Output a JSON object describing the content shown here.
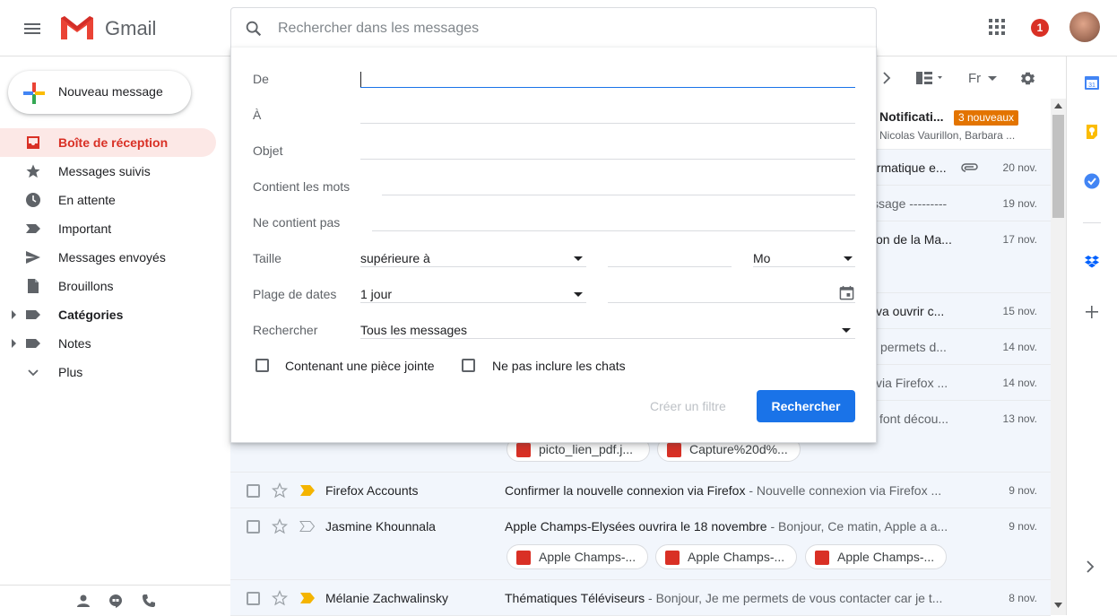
{
  "app": {
    "logo_text": "Gmail",
    "notification_count": "1"
  },
  "search": {
    "placeholder": "Rechercher dans les messages"
  },
  "compose": {
    "label": "Nouveau message"
  },
  "sidebar": {
    "items": [
      {
        "label": "Boîte de réception",
        "icon": "inbox-icon"
      },
      {
        "label": "Messages suivis",
        "icon": "star-icon"
      },
      {
        "label": "En attente",
        "icon": "clock-icon"
      },
      {
        "label": "Important",
        "icon": "important-icon"
      },
      {
        "label": "Messages envoyés",
        "icon": "send-icon"
      },
      {
        "label": "Brouillons",
        "icon": "draft-icon"
      },
      {
        "label": "Catégories",
        "icon": "label-icon"
      },
      {
        "label": "Notes",
        "icon": "label-icon"
      },
      {
        "label": "Plus",
        "icon": "chevron-down-icon"
      }
    ]
  },
  "toolbar": {
    "language": "Fr"
  },
  "promo": {
    "title": "Notificati...",
    "badge": "3 nouveaux",
    "senders": "Nicolas Vaurillon, Barbara ..."
  },
  "emails": [
    {
      "fragment": "ormatique e...",
      "date": "20 nov."
    },
    {
      "fragment": "ssage ---------",
      "date": "19 nov."
    },
    {
      "fragment": "on de la Ma...",
      "date": "17 nov."
    },
    {
      "fragment": "va ouvrir c...",
      "date": "15 nov."
    },
    {
      "fragment": "permets d...",
      "date": "14 nov."
    },
    {
      "fragment": "via Firefox ...",
      "date": "14 nov."
    },
    {
      "fragment": "font décou...",
      "date": "13 nov."
    }
  ],
  "row7_chips": [
    "picto_lien_pdf.j...",
    "Capture%20d%..."
  ],
  "full_rows": [
    {
      "sender": "Firefox Accounts",
      "subject": "Confirmer la nouvelle connexion via Firefox",
      "snippet": " - Nouvelle connexion via Firefox ...",
      "date": "9 nov."
    },
    {
      "sender": "Jasmine Khounnala",
      "subject": "Apple Champs-Elysées ouvrira le 18 novembre",
      "snippet": " - Bonjour, Ce matin, Apple a a...",
      "date": "9 nov.",
      "chips": [
        "Apple Champs-...",
        "Apple Champs-...",
        "Apple Champs-..."
      ]
    },
    {
      "sender": "Mélanie Zachwalinsky",
      "subject": "Thématiques Téléviseurs",
      "snippet": " - Bonjour, Je me permets de vous contacter car je t...",
      "date": "8 nov."
    }
  ],
  "panel": {
    "from_label": "De",
    "to_label": "À",
    "subject_label": "Objet",
    "has_words_label": "Contient les mots",
    "not_has_label": "Ne contient pas",
    "size_label": "Taille",
    "size_operator": "supérieure à",
    "size_unit": "Mo",
    "date_label": "Plage de dates",
    "date_value": "1 jour",
    "search_in_label": "Rechercher",
    "search_in_value": "Tous les messages",
    "attachment_label": "Contenant une pièce jointe",
    "no_chats_label": "Ne pas inclure les chats",
    "create_filter_label": "Créer un filtre",
    "search_button_label": "Rechercher"
  }
}
